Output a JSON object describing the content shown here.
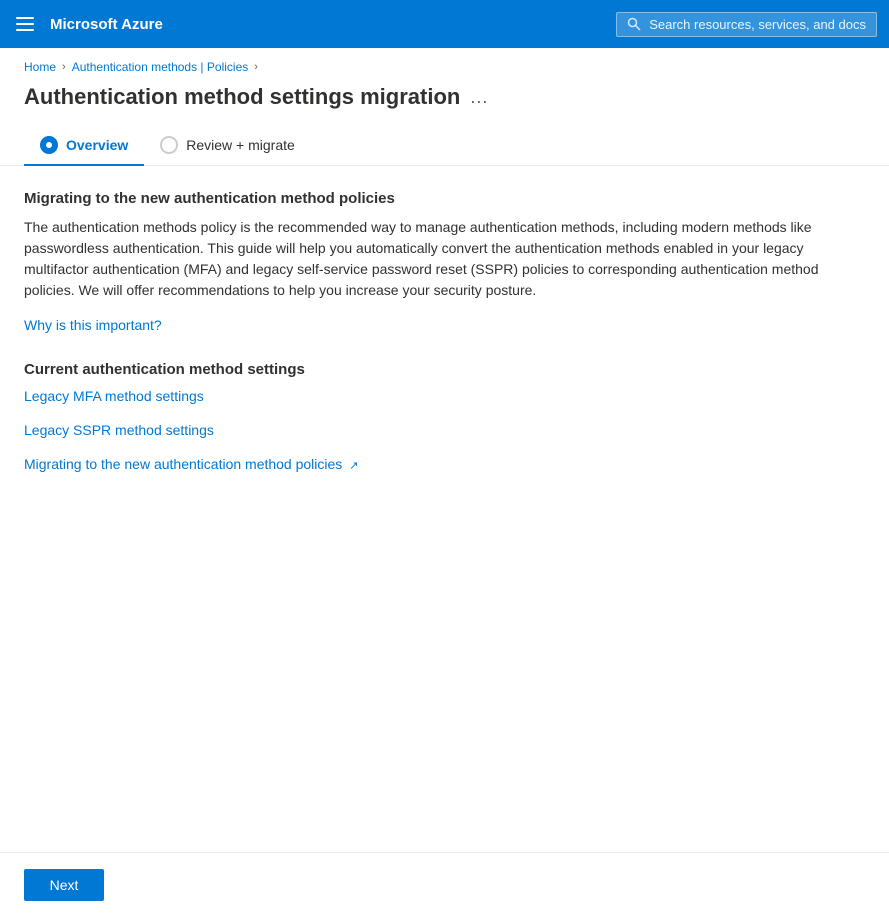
{
  "topbar": {
    "logo": "Microsoft Azure",
    "search_placeholder": "Search resources, services, and docs"
  },
  "breadcrumb": {
    "home": "Home",
    "parent": "Authentication methods | Policies"
  },
  "header": {
    "title": "Authentication method settings migration",
    "more_options": "..."
  },
  "tabs": [
    {
      "id": "overview",
      "label": "Overview",
      "active": true,
      "filled": true
    },
    {
      "id": "review",
      "label": "Review + migrate",
      "active": false,
      "filled": false
    }
  ],
  "content": {
    "main_heading": "Migrating to the new authentication method policies",
    "description": "The authentication methods policy is the recommended way to manage authentication methods, including modern methods like passwordless authentication. This guide will help you automatically convert the authentication methods enabled in your legacy multifactor authentication (MFA) and legacy self-service password reset (SSPR) policies to corresponding authentication method policies. We will offer recommendations to help you increase your security posture.",
    "important_link": "Why is this important?",
    "current_settings_heading": "Current authentication method settings",
    "links": [
      {
        "label": "Legacy MFA method settings",
        "external": false
      },
      {
        "label": "Legacy SSPR method settings",
        "external": false
      },
      {
        "label": "Migrating to the new authentication method policies",
        "external": true
      }
    ]
  },
  "footer": {
    "next_button": "Next"
  }
}
